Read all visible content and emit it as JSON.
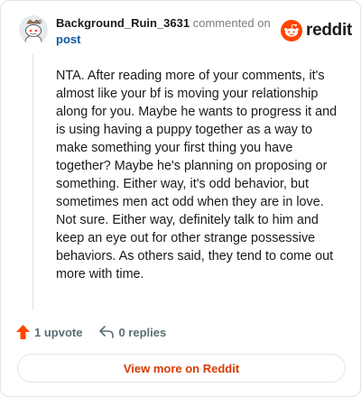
{
  "comment": {
    "username": "Background_Ruin_3631",
    "action_text": "commented on",
    "target_text": "post",
    "body": "NTA. After reading more of your comments, it's almost like your bf is moving your relationship along for you. Maybe he wants to progress it and is using having a puppy together as a way to make something your first thing you have together? Maybe he's planning on proposing or something. Either way, it's odd behavior, but sometimes men act odd when they are in love. Not sure. Either way, definitely talk to him and keep an eye out for other strange possessive behaviors. As others said, they tend to come out more with time."
  },
  "brand": {
    "name": "reddit",
    "color": "#ff4500"
  },
  "actions": {
    "upvote_label": "1 upvote",
    "upvote_icon": "upvote-arrow-icon",
    "replies_label": "0 replies",
    "replies_icon": "reply-arrow-icon"
  },
  "cta": {
    "view_more_label": "View more on Reddit"
  },
  "colors": {
    "upvote": "#ff4500",
    "link": "#0a5a9c",
    "cta_text": "#d93a00"
  }
}
